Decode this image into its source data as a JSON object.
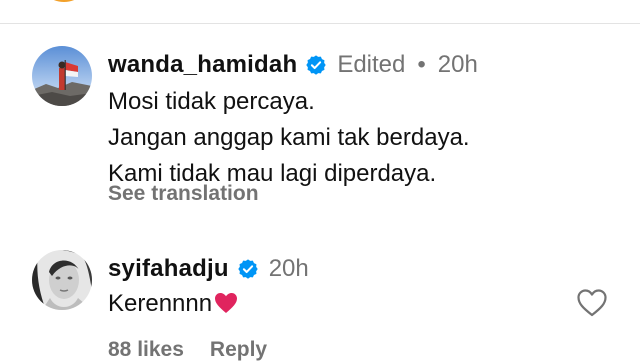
{
  "comments": [
    {
      "username": "wanda_hamidah",
      "edited": "Edited",
      "separator": "•",
      "time": "20h",
      "lines": [
        "Mosi tidak percaya.",
        "Jangan anggap kami tak berdaya.",
        "Kami tidak mau lagi diperdaya."
      ],
      "see_translation": "See translation"
    },
    {
      "username": "syifahadju",
      "time": "20h",
      "text": "Kerennnn",
      "likes": "88 likes",
      "reply": "Reply"
    }
  ],
  "colors": {
    "verified_blue": "#0095f6",
    "muted_text": "#737373",
    "heart_emoji": "#e0245e"
  },
  "icons": {
    "verified": "verified-badge-icon",
    "like": "heart-outline-icon",
    "emoji": "red-heart-emoji-icon"
  }
}
